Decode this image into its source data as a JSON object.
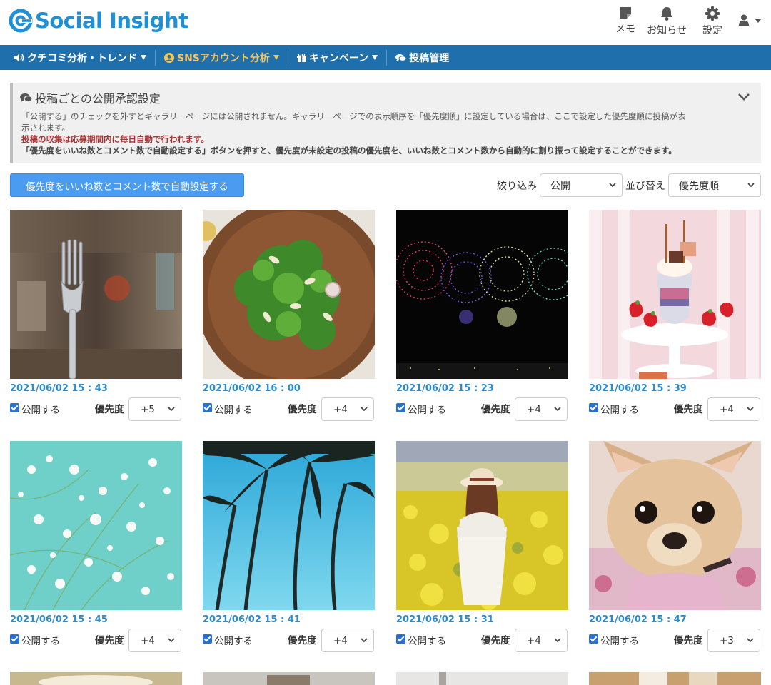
{
  "app": {
    "logo_text": "Social Insight",
    "brand_color": "#1f8fd6"
  },
  "header": {
    "tools": [
      {
        "label": "メモ",
        "icon": "memo-icon"
      },
      {
        "label": "お知らせ",
        "icon": "bell-icon"
      },
      {
        "label": "設定",
        "icon": "gear-icon"
      }
    ],
    "user_icon": "user-icon"
  },
  "nav": {
    "color": "#1f6fad",
    "items": [
      {
        "label": "クチコミ分析・トレンド",
        "icon": "volume-icon",
        "dropdown": true,
        "active": false
      },
      {
        "label": "SNSアカウント分析",
        "icon": "user-circle-icon",
        "dropdown": true,
        "active": true
      },
      {
        "label": "キャンペーン",
        "icon": "gift-icon",
        "dropdown": true,
        "active": false
      },
      {
        "label": "投稿管理",
        "icon": "comments-icon",
        "dropdown": false,
        "active": false
      }
    ]
  },
  "info": {
    "title": "投稿ごとの公開承認設定",
    "text1": "「公開する」のチェックを外すとギャラリーページには公開されません。ギャラリーページでの表示順序を「優先度順」に設定している場合は、ここで設定した優先度順に投稿が表示されます。",
    "text1_line1": "「公開する」のチェックを外すとギャラリーページには公開されません。ギャラリーページでの表示順序を「優先度順」に設定している場合は、ここで設定した優先度順に投稿が表",
    "text1_line2": "示されます。",
    "text_red": "投稿の収集は応募期間内に毎日自動で行われます。",
    "text_bold": "「優先度をいいね数とコメント数で自動設定する」ボタンを押すと、優先度が未設定の投稿の優先度を、いいね数とコメント数から自動的に割り振って設定することができます。"
  },
  "toolbar": {
    "auto_button": "優先度をいいね数とコメント数で自動設定する",
    "filter_label": "絞り込み",
    "filter_value": "公開",
    "sort_label": "並び替え",
    "sort_value": "優先度順"
  },
  "card_labels": {
    "publish": "公開する",
    "priority": "優先度"
  },
  "posts": [
    {
      "date": "2021/06/02 15 : 43",
      "priority": "+5",
      "published": true
    },
    {
      "date": "2021/06/02 16 : 00",
      "priority": "+4",
      "published": true
    },
    {
      "date": "2021/06/02 15 : 23",
      "priority": "+4",
      "published": true
    },
    {
      "date": "2021/06/02 15 : 39",
      "priority": "+4",
      "published": true
    },
    {
      "date": "2021/06/02 15 : 45",
      "priority": "+4",
      "published": true
    },
    {
      "date": "2021/06/02 15 : 41",
      "priority": "+4",
      "published": true
    },
    {
      "date": "2021/06/02 15 : 31",
      "priority": "+4",
      "published": true
    },
    {
      "date": "2021/06/02 15 : 47",
      "priority": "+3",
      "published": true
    }
  ]
}
